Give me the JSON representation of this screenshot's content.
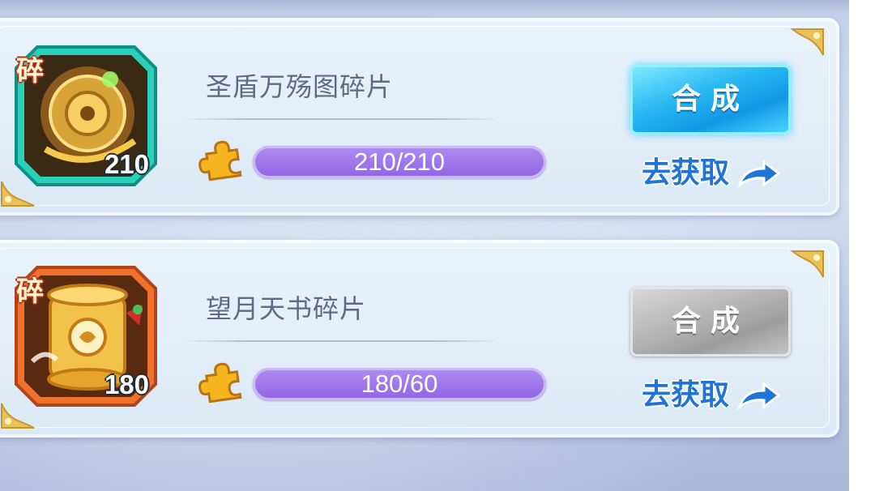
{
  "items": [
    {
      "badge": "碎",
      "count": "210",
      "name": "圣盾万殇图碎片",
      "progress_text": "210/210",
      "progress_fraction": 1.0,
      "compose_label": "合成",
      "compose_state": "active",
      "get_label": "去获取",
      "icon_theme": "gold-shield-scroll",
      "frame_color": "#1fc1b0"
    },
    {
      "badge": "碎",
      "count": "180",
      "name": "望月天书碎片",
      "progress_text": "180/60",
      "progress_fraction": 1.0,
      "compose_label": "合成",
      "compose_state": "disabled",
      "get_label": "去获取",
      "icon_theme": "golden-scroll-book",
      "frame_color": "#f06a2c"
    }
  ]
}
